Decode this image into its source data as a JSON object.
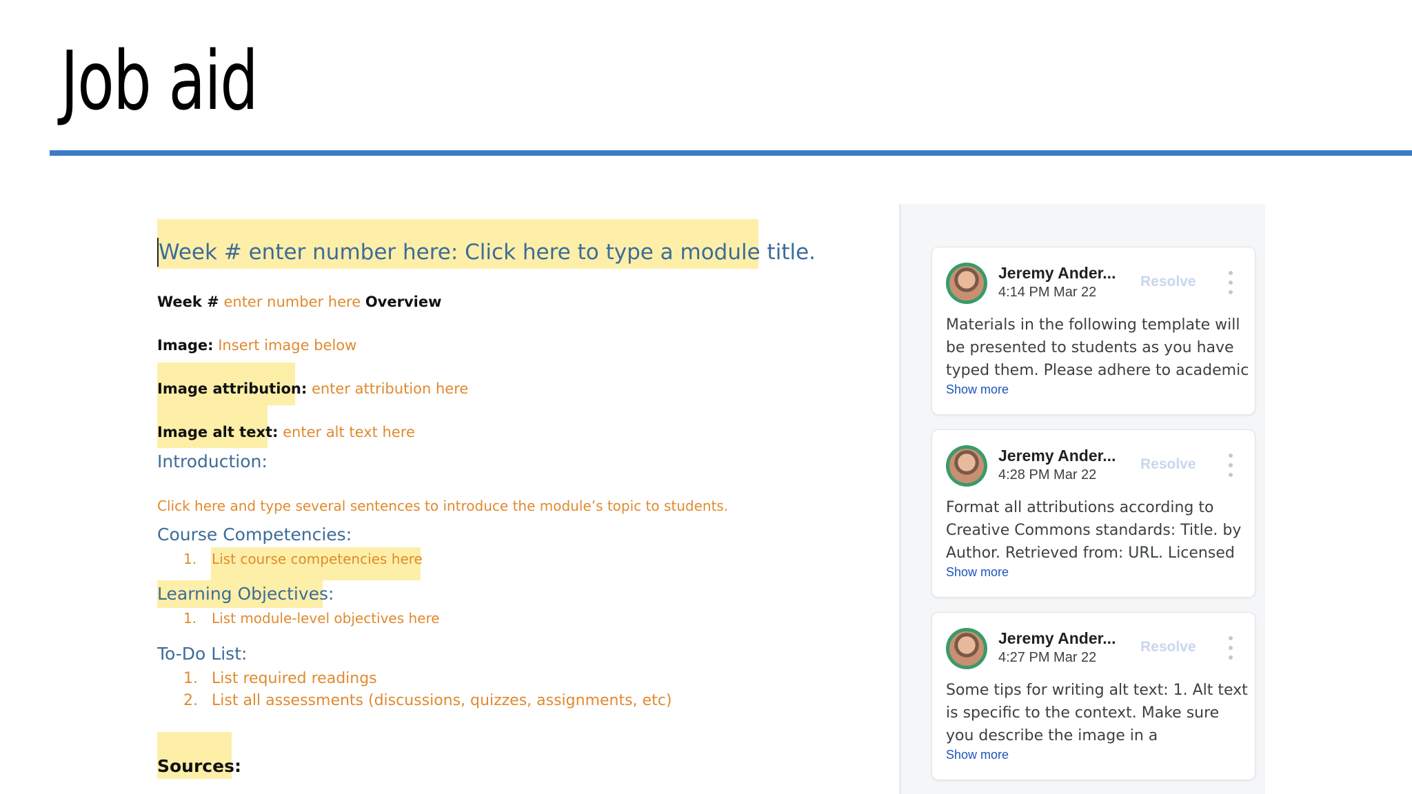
{
  "slide": {
    "title": "Job aid"
  },
  "document": {
    "week_title": "Week # enter number here: Click here to type a module title.",
    "overview_week_label": "Week #",
    "overview_placeholder": "enter number here",
    "overview_label": "Overview",
    "image_label": "Image:",
    "image_placeholder": "Insert image below",
    "attribution_label": "Image attribution:",
    "attribution_placeholder": "enter attribution here",
    "alt_text_label": "Image alt text:",
    "alt_text_placeholder": "enter alt text here",
    "introduction_heading": "Introduction:",
    "introduction_placeholder": "Click here and type several sentences to introduce the module’s topic to students.",
    "competencies_heading": "Course Competencies:",
    "competencies_items": [
      {
        "num": "1.",
        "text": "List course competencies here"
      }
    ],
    "objectives_heading": "Learning Objectives:",
    "objectives_items": [
      {
        "num": "1.",
        "text": "List module-level objectives here"
      }
    ],
    "todo_heading": "To-Do List:",
    "todo_items": [
      {
        "num": "1.",
        "text": "List required readings"
      },
      {
        "num": "2.",
        "text": "List all assessments (discussions, quizzes, assignments, etc)"
      }
    ],
    "sources_label": "Sources:"
  },
  "comments": [
    {
      "author": "Jeremy Ander...",
      "time": "4:14 PM Mar 22",
      "resolve_label": "Resolve",
      "body": "Materials in the following template will be presented to students as you have typed them. Please adhere to academic",
      "show_more": "Show more"
    },
    {
      "author": "Jeremy Ander...",
      "time": "4:28 PM Mar 22",
      "resolve_label": "Resolve",
      "body": "Format all attributions according to Creative Commons standards: Title. by Author. Retrieved from: URL. Licensed",
      "show_more": "Show more"
    },
    {
      "author": "Jeremy Ander...",
      "time": "4:27 PM Mar 22",
      "resolve_label": "Resolve",
      "body": "Some tips for writing alt text: 1. Alt text is specific to the context. Make sure you describe the image in a",
      "show_more": "Show more"
    }
  ],
  "colors": {
    "title_rule": "#3d7cc4",
    "highlight": "#fdefa8",
    "placeholder_orange": "#e08a2e",
    "heading_blue": "#3d6b9a",
    "link_blue": "#1a56b8"
  }
}
